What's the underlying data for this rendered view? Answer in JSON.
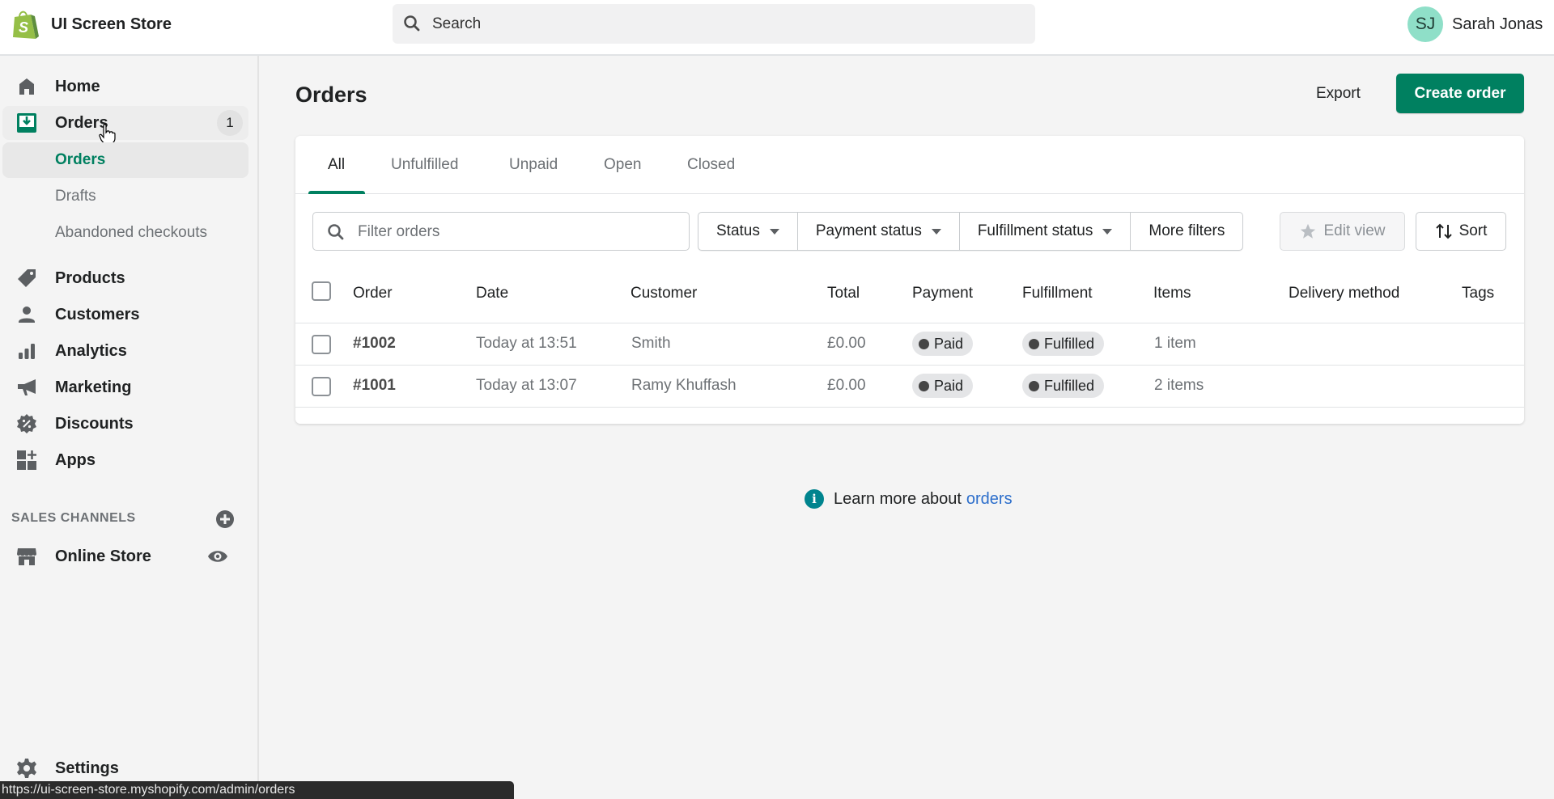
{
  "topbar": {
    "store_name": "UI Screen Store",
    "search_placeholder": "Search",
    "user_initials": "SJ",
    "user_name": "Sarah Jonas",
    "avatar_color": "#8fdfc8"
  },
  "sidebar": {
    "items": [
      {
        "label": "Home",
        "icon": "home-icon"
      },
      {
        "label": "Orders",
        "icon": "orders-icon",
        "badge": "1"
      },
      {
        "label": "Products",
        "icon": "tag-icon"
      },
      {
        "label": "Customers",
        "icon": "person-icon"
      },
      {
        "label": "Analytics",
        "icon": "bar-chart-icon"
      },
      {
        "label": "Marketing",
        "icon": "megaphone-icon"
      },
      {
        "label": "Discounts",
        "icon": "discount-icon"
      },
      {
        "label": "Apps",
        "icon": "apps-icon"
      }
    ],
    "orders_subitems": [
      {
        "label": "Orders",
        "active": true
      },
      {
        "label": "Drafts"
      },
      {
        "label": "Abandoned checkouts"
      }
    ],
    "sales_channels_title": "SALES CHANNELS",
    "online_store": "Online Store",
    "settings": "Settings"
  },
  "main": {
    "title": "Orders",
    "export_label": "Export",
    "create_label": "Create order",
    "accent_color": "#008060",
    "tabs": [
      {
        "label": "All",
        "active": true
      },
      {
        "label": "Unfulfilled"
      },
      {
        "label": "Unpaid"
      },
      {
        "label": "Open"
      },
      {
        "label": "Closed"
      }
    ],
    "filter_placeholder": "Filter orders",
    "filters": {
      "status": "Status",
      "payment_status": "Payment status",
      "fulfillment_status": "Fulfillment status",
      "more_filters": "More filters"
    },
    "edit_view": "Edit view",
    "sort": "Sort",
    "columns": [
      "Order",
      "Date",
      "Customer",
      "Total",
      "Payment",
      "Fulfillment",
      "Items",
      "Delivery method",
      "Tags"
    ],
    "rows": [
      {
        "order": "#1002",
        "date": "Today at 13:51",
        "customer": "Smith",
        "total": "£0.00",
        "payment": "Paid",
        "fulfillment": "Fulfilled",
        "items": "1 item",
        "delivery": "",
        "tags": ""
      },
      {
        "order": "#1001",
        "date": "Today at 13:07",
        "customer": "Ramy Khuffash",
        "total": "£0.00",
        "payment": "Paid",
        "fulfillment": "Fulfilled",
        "items": "2 items",
        "delivery": "",
        "tags": ""
      }
    ],
    "learn_more_text": "Learn more about",
    "learn_more_link": "orders"
  },
  "status_bar": {
    "url": "https://ui-screen-store.myshopify.com/admin/orders"
  }
}
